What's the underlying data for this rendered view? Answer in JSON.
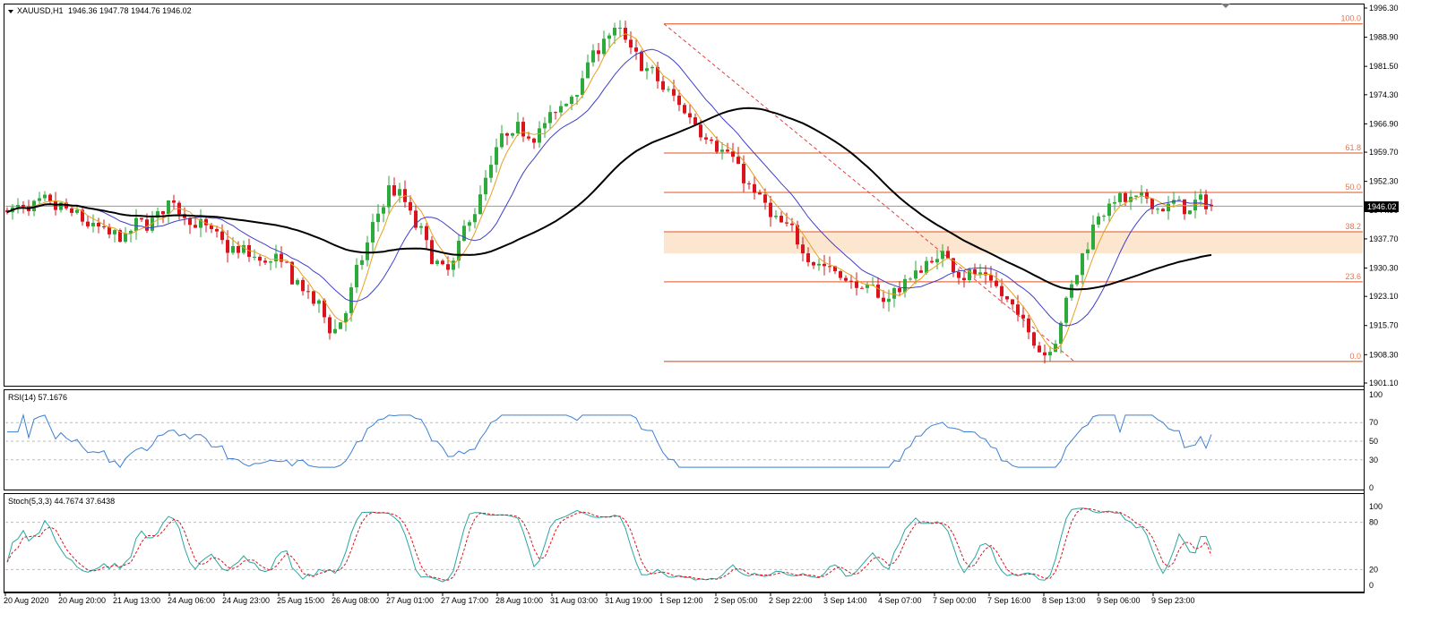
{
  "header": {
    "symbol": "XAUUSD,H1",
    "ohlc": "1946.36 1947.78 1944.76 1946.02"
  },
  "price_panel": {
    "current_price": "1946.02",
    "y_ticks": [
      "1996.30",
      "1988.90",
      "1981.50",
      "1974.30",
      "1966.90",
      "1959.70",
      "1952.30",
      "1944.90",
      "1937.70",
      "1930.30",
      "1923.10",
      "1915.70",
      "1908.30",
      "1901.10"
    ],
    "fib_levels": [
      {
        "label": "100.0",
        "price": 1992.3
      },
      {
        "label": "61.8",
        "price": 1959.5
      },
      {
        "label": "50.0",
        "price": 1949.5
      },
      {
        "label": "38.2",
        "price": 1939.5
      },
      {
        "label": "23.6",
        "price": 1926.8
      },
      {
        "label": "0.0",
        "price": 1906.6
      }
    ],
    "zone": {
      "from": 1934.0,
      "to": 1939.5,
      "color": "#fde6cf"
    },
    "colors": {
      "up": "#2eaa3c",
      "down": "#d9141d",
      "fast_ma": "#e8a020",
      "mid_ma": "#3f3fc8",
      "slow_ma": "#000000",
      "fib": "#e8734a"
    }
  },
  "rsi_panel": {
    "label": "RSI(14) 57.1676",
    "levels": [
      "100",
      "70",
      "50",
      "30",
      "0"
    ],
    "color": "#3c7fd4"
  },
  "stoch_panel": {
    "label": "Stoch(5,3,3) 44.7674 37.6438",
    "levels": [
      "100",
      "80",
      "20",
      "0"
    ],
    "colors": {
      "main": "#2aa7a0",
      "signal": "#d9141d"
    }
  },
  "x_axis": {
    "labels": [
      "20 Aug 2020",
      "20 Aug 20:00",
      "21 Aug 13:00",
      "24 Aug 06:00",
      "24 Aug 23:00",
      "25 Aug 15:00",
      "26 Aug 08:00",
      "27 Aug 01:00",
      "27 Aug 17:00",
      "28 Aug 10:00",
      "31 Aug 03:00",
      "31 Aug 19:00",
      "1 Sep 12:00",
      "2 Sep 05:00",
      "2 Sep 22:00",
      "3 Sep 14:00",
      "4 Sep 07:00",
      "7 Sep 00:00",
      "7 Sep 16:00",
      "8 Sep 13:00",
      "9 Sep 06:00",
      "9 Sep 23:00"
    ]
  },
  "chart_data": {
    "type": "candlestick",
    "symbol": "XAUUSD",
    "timeframe": "H1",
    "y_range": [
      1901.1,
      1996.3
    ],
    "price_path": [
      [
        "20 Aug 2020",
        1945
      ],
      [
        "20 Aug 20:00",
        1945
      ],
      [
        "21 Aug 13:00",
        1937
      ],
      [
        "24 Aug 06:00",
        1947
      ],
      [
        "24 Aug 23:00",
        1935
      ],
      [
        "25 Aug 15:00",
        1931
      ],
      [
        "26 Aug 08:00",
        1914
      ],
      [
        "27 Aug 01:00",
        1953
      ],
      [
        "27 Aug 17:00",
        1927
      ],
      [
        "28 Aug 10:00",
        1963
      ],
      [
        "31 Aug 03:00",
        1968
      ],
      [
        "31 Aug 19:00",
        1992
      ],
      [
        "1 Sep 12:00",
        1975
      ],
      [
        "2 Sep 05:00",
        1962
      ],
      [
        "2 Sep 22:00",
        1942
      ],
      [
        "3 Sep 14:00",
        1930
      ],
      [
        "4 Sep 07:00",
        1922
      ],
      [
        "7 Sep 00:00",
        1934
      ],
      [
        "7 Sep 16:00",
        1926
      ],
      [
        "8 Sep 13:00",
        1908
      ],
      [
        "9 Sep 06:00",
        1948
      ],
      [
        "9 Sep 23:00",
        1946
      ]
    ],
    "fibonacci": {
      "high": 1992.3,
      "low": 1906.6,
      "levels": [
        100.0,
        61.8,
        50.0,
        38.2,
        23.6,
        0.0
      ]
    },
    "indicators": [
      "Moving Average (fast)",
      "Moving Average (medium)",
      "Moving Average (slow)",
      "RSI(14)",
      "Stochastic(5,3,3)"
    ],
    "rsi_last": 57.1676,
    "stoch_last": [
      44.7674,
      37.6438
    ]
  }
}
